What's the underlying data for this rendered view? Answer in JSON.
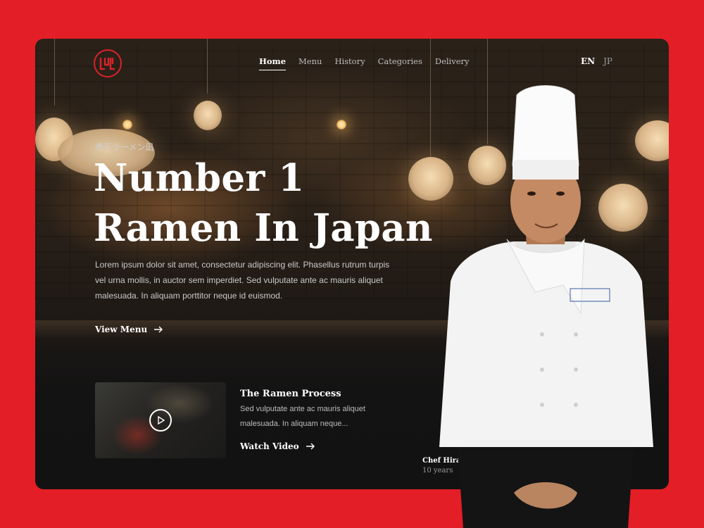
{
  "brand": {
    "logo_text": "MIL",
    "logo_icon": "ramen-logo-icon"
  },
  "nav": {
    "items": [
      {
        "label": "Home",
        "active": true
      },
      {
        "label": "Menu",
        "active": false
      },
      {
        "label": "History",
        "active": false
      },
      {
        "label": "Categories",
        "active": false
      },
      {
        "label": "Delivery",
        "active": false
      }
    ]
  },
  "lang": {
    "en": "EN",
    "jp": "JP"
  },
  "hero": {
    "eyebrow": "煮干ラーメン凪",
    "title_line1": "Number 1",
    "title_line2": "Ramen In Japan",
    "description": "Lorem ipsum dolor sit amet, consectetur adipiscing elit. Phasellus rutrum turpis vel urna mollis, in auctor sem imperdiet. Sed vulputate ante ac mauris aliquet malesuada. In aliquam porttitor neque id euismod.",
    "cta": "View Menu"
  },
  "video": {
    "title": "The Ramen Process",
    "description": "Sed vulputate ante ac mauris aliquet malesuada. In aliquam neque...",
    "cta": "Watch Video"
  },
  "chef": {
    "name": "Chef Hirai Yamamoto",
    "years": "10 years"
  },
  "colors": {
    "brand_red": "#e41e26",
    "logo_red": "#d9232a",
    "text_white": "#ffffff"
  }
}
